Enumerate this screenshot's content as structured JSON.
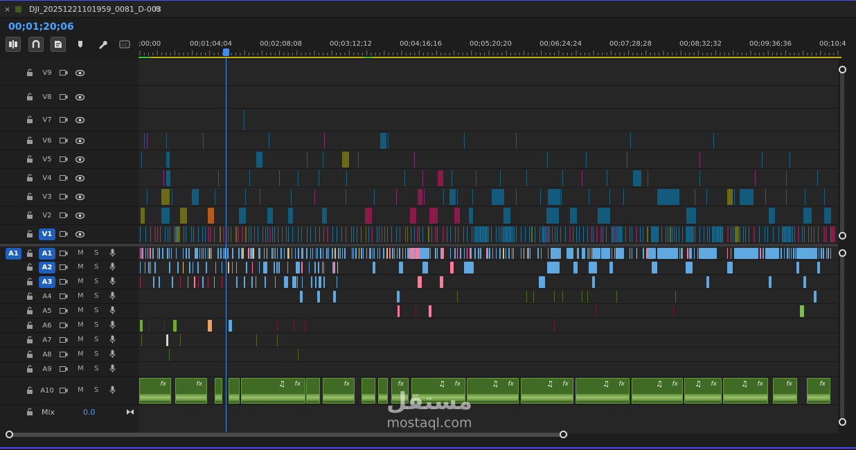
{
  "tab": {
    "close": "×",
    "title": "DJI_20251221101959_0081_D-003",
    "menu": "≡"
  },
  "timecode": "00;01;20;06",
  "tools": [
    "insert-snap-icon",
    "magnet-icon",
    "linked-selection-icon",
    "marker-icon",
    "wrench-icon",
    "captions-icon"
  ],
  "ruler": {
    "labels": [
      ";00;00",
      "00;01;04;04",
      "00;02;08;08",
      "00;03;12;12",
      "00;04;16;16",
      "00;05;20;20",
      "00;06;24;24",
      "00;07;28;28",
      "00;08;32;32",
      "00;09;36;36",
      "00;10;4"
    ]
  },
  "video_tracks": [
    {
      "name": "V9"
    },
    {
      "name": "V8"
    },
    {
      "name": "V7"
    },
    {
      "name": "V6"
    },
    {
      "name": "V5"
    },
    {
      "name": "V4"
    },
    {
      "name": "V3"
    },
    {
      "name": "V2"
    },
    {
      "name": "V1",
      "selected": true
    }
  ],
  "audio_tracks": [
    {
      "name": "A1",
      "selected": true,
      "source": "A1"
    },
    {
      "name": "A2",
      "selected": true
    },
    {
      "name": "A3",
      "selected": true
    },
    {
      "name": "A4"
    },
    {
      "name": "A5"
    },
    {
      "name": "A6"
    },
    {
      "name": "A7"
    },
    {
      "name": "A8"
    },
    {
      "name": "A9"
    },
    {
      "name": "A10"
    }
  ],
  "audio_buttons": {
    "mute": "M",
    "solo": "S"
  },
  "mix": {
    "label": "Mix",
    "value": "0.0"
  },
  "clip_labels": {
    "fx": "fx",
    "note": "♫"
  },
  "watermark": {
    "arabic": "مستقل",
    "latin": "mostaql.com"
  },
  "colors": {
    "accent": "#4aa3ff",
    "track_select": "#1f5fbf",
    "audio_clip": "#5fa8e0",
    "video_clip": "#135b7d",
    "music_clip": "#3f6b25",
    "pink": "#e0507a"
  }
}
